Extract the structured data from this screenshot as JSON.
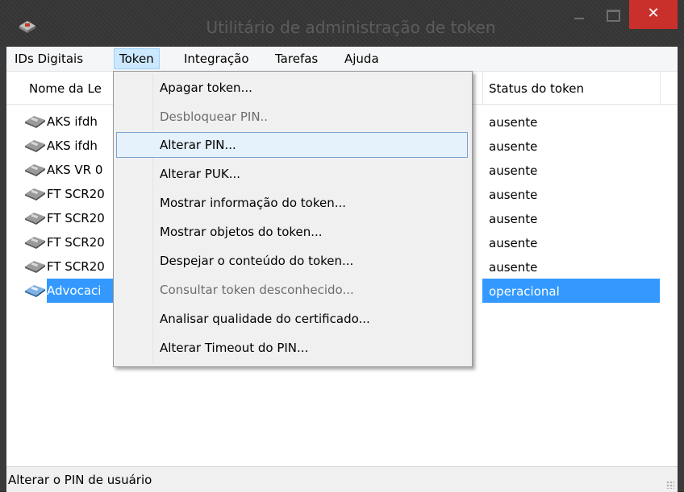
{
  "window": {
    "title": "Utilitário de administração de token",
    "close_glyph": "✕"
  },
  "menubar": {
    "items": [
      {
        "label": "IDs Digitais"
      },
      {
        "label": "Token"
      },
      {
        "label": "Integração"
      },
      {
        "label": "Tarefas"
      },
      {
        "label": "Ajuda"
      }
    ],
    "active": "Token"
  },
  "list": {
    "columns": [
      "Nome da Le",
      "Status do token"
    ],
    "rows": [
      {
        "name": "AKS ifdh",
        "status": "ausente",
        "icon": "card-reader-icon"
      },
      {
        "name": "AKS ifdh",
        "status": "ausente",
        "icon": "card-reader-icon"
      },
      {
        "name": "AKS VR 0",
        "status": "ausente",
        "icon": "card-reader-icon"
      },
      {
        "name": "FT SCR20",
        "status": "ausente",
        "icon": "card-reader-icon"
      },
      {
        "name": "FT SCR20",
        "status": "ausente",
        "icon": "card-reader-icon"
      },
      {
        "name": "FT SCR20",
        "status": "ausente",
        "icon": "card-reader-icon"
      },
      {
        "name": "FT SCR20",
        "status": "ausente",
        "icon": "card-reader-icon"
      },
      {
        "name": "Advocaci",
        "status": "operacional",
        "icon": "card-reader-active-icon",
        "selected": true
      }
    ]
  },
  "token_menu": {
    "items": [
      {
        "label": "Apagar token...",
        "enabled": true
      },
      {
        "label": "Desbloquear PIN..",
        "enabled": false
      },
      {
        "label": "Alterar PIN...",
        "enabled": true,
        "highlighted": true
      },
      {
        "label": "Alterar PUK...",
        "enabled": true
      },
      {
        "label": "Mostrar informação do token...",
        "enabled": true
      },
      {
        "label": "Mostrar objetos do token...",
        "enabled": true
      },
      {
        "label": "Despejar o conteúdo do token...",
        "enabled": true
      },
      {
        "label": "Consultar token desconhecido...",
        "enabled": false
      },
      {
        "label": "Analisar qualidade do certificado...",
        "enabled": true
      },
      {
        "label": "Alterar Timeout do PIN...",
        "enabled": true
      }
    ]
  },
  "statusbar": {
    "text": "Alterar o PIN de usuário"
  },
  "colors": {
    "selection": "#3399ff",
    "menu_highlight": "#e5f1fb",
    "close_button": "#c9302c"
  }
}
